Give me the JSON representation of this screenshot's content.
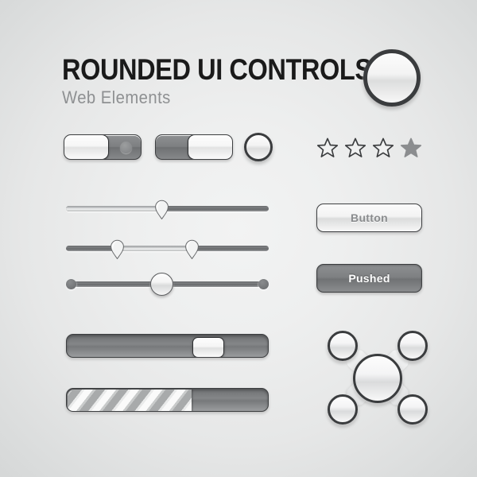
{
  "page": {
    "title": "ROUNDED UI CONTROLS",
    "subtitle": "Web Elements",
    "background_color_center": "#eeefef",
    "background_color_edge": "#d4d6d6"
  },
  "controls": {
    "toggle_on": {
      "name": "toggle-switch-left",
      "state": "off",
      "knob_side": "left",
      "has_indicator_dot": true
    },
    "toggle_off": {
      "name": "toggle-switch-right",
      "state": "on",
      "knob_side": "right",
      "has_indicator_dot": false
    },
    "round_button_small": {
      "name": "round-button-small",
      "diameter": 36
    },
    "round_button_large": {
      "name": "round-button-large",
      "diameter": 72
    },
    "rating": {
      "label": "star-rating",
      "total": 4,
      "filled_index": 3,
      "stars": [
        "outline",
        "outline",
        "outline",
        "filled"
      ],
      "fill_color": "#8b8d8f",
      "outline_color": "#3a3c3e"
    },
    "slider_single": {
      "name": "slider-single-handle",
      "value_percent": 47,
      "handle_shape": "pin"
    },
    "slider_range": {
      "name": "slider-range",
      "low_percent": 25,
      "high_percent": 62,
      "handle_shape": "pin"
    },
    "slider_circle": {
      "name": "slider-circle-handle",
      "value_percent": 47,
      "handle_shape": "circle",
      "has_end_caps": true
    },
    "scrollbar": {
      "name": "scrollbar-horizontal",
      "handle_position_percent": 63
    },
    "progress": {
      "name": "progress-bar-striped",
      "value_percent": 62,
      "stripe_style": "diagonal"
    },
    "buttons": {
      "normal_label": "Button",
      "pushed_label": "Pushed",
      "normal_text_color": "#8a8c8e",
      "pushed_text_color": "#ffffff"
    },
    "dpad": {
      "name": "directional-pad",
      "center_label": "",
      "nodes": [
        "top-left",
        "top-right",
        "center",
        "bottom-left",
        "bottom-right"
      ]
    }
  }
}
